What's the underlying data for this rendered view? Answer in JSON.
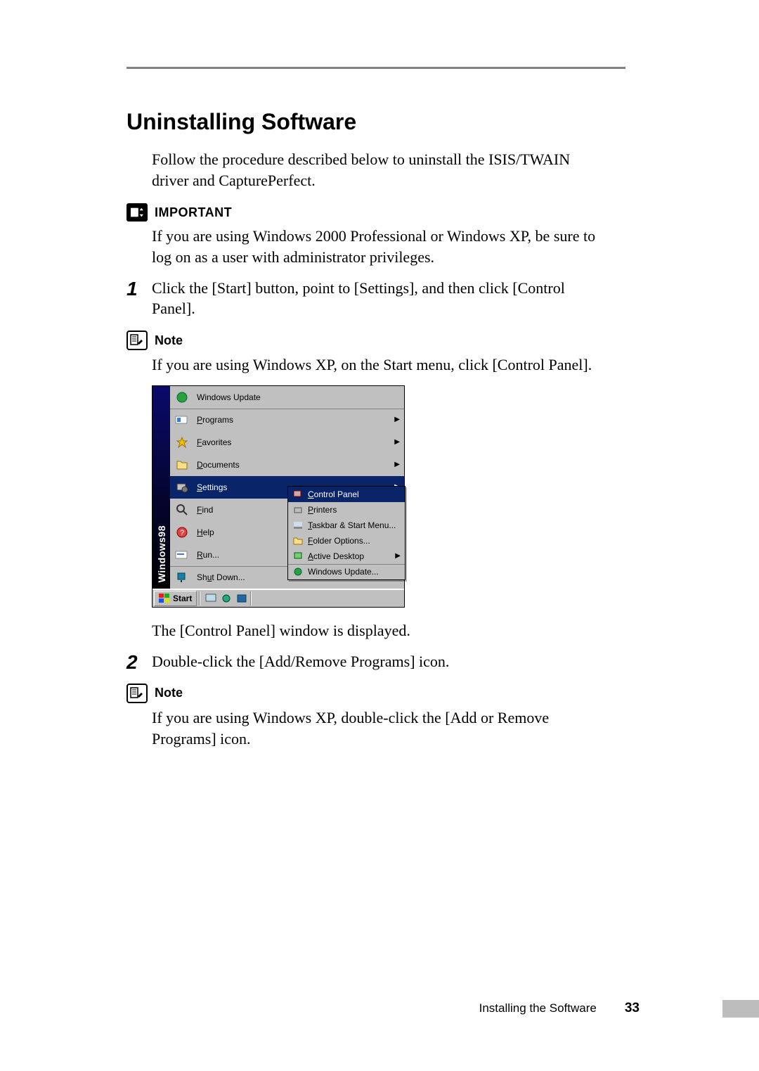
{
  "heading": "Uninstalling Software",
  "intro": "Follow the procedure described below to uninstall the ISIS/TWAIN driver and CapturePerfect.",
  "important_label": "IMPORTANT",
  "important_text": "If you are using Windows 2000 Professional or Windows XP, be sure to log on as a user with administrator privileges.",
  "step1_num": "1",
  "step1_text": "Click the [Start] button, point to [Settings], and then click [Control Panel].",
  "note1_label": "Note",
  "note1_text": "If you are using Windows XP, on the Start menu, click [Control Panel].",
  "startmenu": {
    "side_label": "Windows98",
    "items": {
      "windows_update": "Windows Update",
      "programs": "Programs",
      "favorites": "Favorites",
      "documents": "Documents",
      "settings": "Settings",
      "find": "Find",
      "help": "Help",
      "run": "Run...",
      "shutdown": "Shut Down..."
    },
    "submenu": {
      "control_panel": "Control Panel",
      "printers": "Printers",
      "taskbar": "Taskbar & Start Menu...",
      "folder_options": "Folder Options...",
      "active_desktop": "Active Desktop",
      "windows_update": "Windows Update..."
    },
    "start_button": "Start"
  },
  "after_image_text": "The [Control Panel] window is displayed.",
  "step2_num": "2",
  "step2_text": "Double-click the [Add/Remove Programs] icon.",
  "note2_label": "Note",
  "note2_text": "If you are using Windows XP, double-click the [Add or Remove Programs] icon.",
  "footer_title": "Installing the Software",
  "footer_page": "33"
}
